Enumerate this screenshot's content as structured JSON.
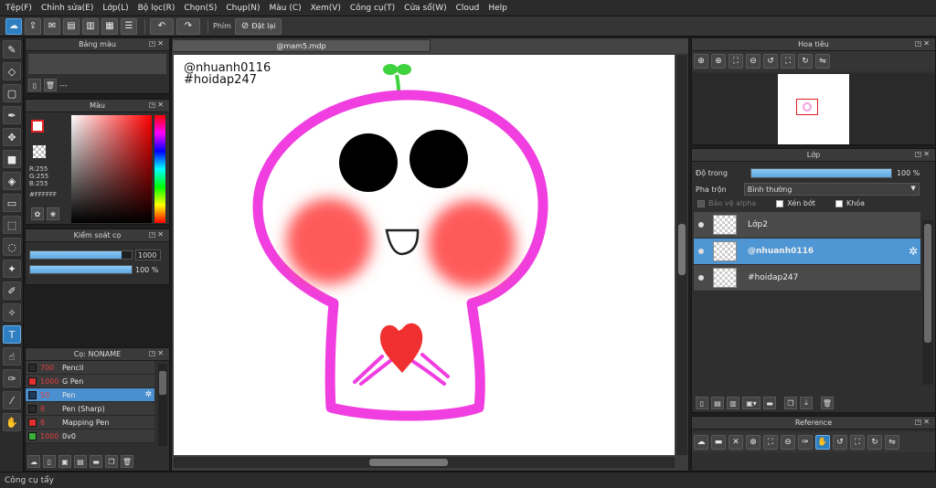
{
  "menu": [
    "Tệp(F)",
    "Chỉnh sửa(E)",
    "Lớp(L)",
    "Bộ lọc(R)",
    "Chọn(S)",
    "Chụp(N)",
    "Màu (C)",
    "Xem(V)",
    "Công cụ(T)",
    "Cửa sổ(W)",
    "Cloud",
    "Help"
  ],
  "toolbar": {
    "snap_label": "Phím",
    "reset_label": "Đặt lại"
  },
  "palette": {
    "title": "Bảng màu",
    "name": "---"
  },
  "color": {
    "title": "Màu",
    "r": "R:255",
    "g": "G:255",
    "b": "B:255",
    "hex": "#FFFFFF",
    "fg": "#ffffff",
    "bg": "#f6c7a8",
    "fg_border": "#e52222"
  },
  "brush_control": {
    "title": "Kiểm soát cọ",
    "size_value": "1000",
    "size_fraction": 0.9,
    "opacity_value": "100 %",
    "opacity_fraction": 1.0
  },
  "brush_list": {
    "title": "Cọ: NONAME",
    "items": [
      {
        "size": "700",
        "name": "Pencil",
        "color": "#2a2a2a",
        "active": false
      },
      {
        "size": "1000",
        "name": "G Pen",
        "color": "#e03030",
        "active": false
      },
      {
        "size": "50",
        "name": "Pen",
        "color": "#1e3a5a",
        "active": true
      },
      {
        "size": "8",
        "name": "Pen (Sharp)",
        "color": "#2a2a2a",
        "active": false
      },
      {
        "size": "8",
        "name": "Mapping Pen",
        "color": "#e03030",
        "active": false
      },
      {
        "size": "1000",
        "name": "0v0",
        "color": "#3ab03a",
        "active": false
      }
    ]
  },
  "canvas": {
    "tab": "@mam5.mdp",
    "text_line1": "@nhuanh0116",
    "text_line2": "#hoidap247",
    "stroke_color": "#f03ee0",
    "blush_color": "#ff5a5a",
    "heart_color": "#f03030",
    "sprout_color": "#3fd23f"
  },
  "navigator": {
    "title": "Hoa tiêu"
  },
  "layers": {
    "title": "Lớp",
    "opacity_label": "Độ trong",
    "opacity_value": "100 %",
    "opacity_fraction": 1.0,
    "blend_label": "Pha trộn",
    "blend_value": "Bình thường",
    "check_alpha": "Bảo vệ alpha",
    "check_clip": "Xén bớt",
    "check_lock": "Khóa",
    "items": [
      {
        "name": "Lớp2",
        "active": false
      },
      {
        "name": "@nhuanh0116",
        "active": true
      },
      {
        "name": "#hoidap247",
        "active": false
      }
    ]
  },
  "reference": {
    "title": "Reference"
  },
  "status": "Công cụ tẩy"
}
